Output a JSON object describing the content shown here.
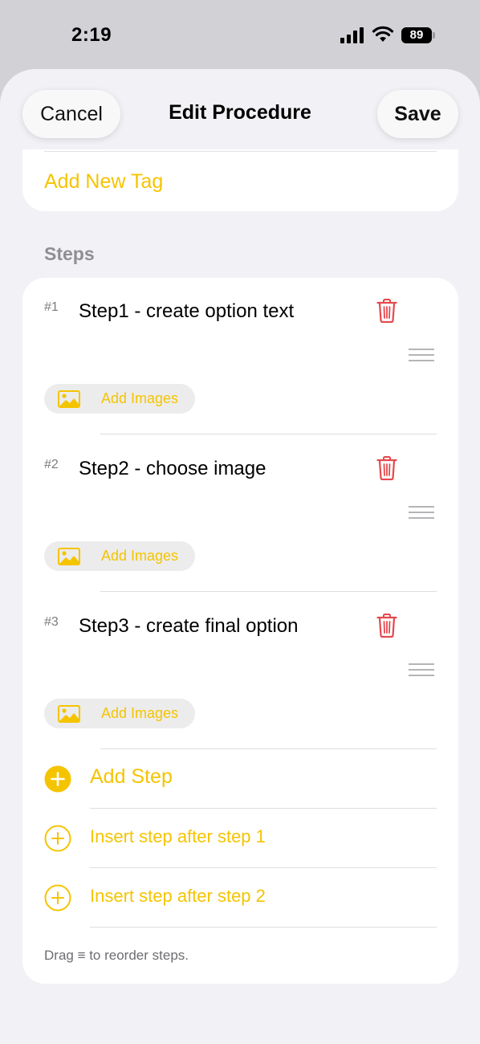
{
  "status_bar": {
    "time": "2:19",
    "battery_level": "89"
  },
  "nav": {
    "cancel_label": "Cancel",
    "title": "Edit Procedure",
    "save_label": "Save"
  },
  "tags": {
    "add_tag_label": "Add New Tag"
  },
  "steps_section": {
    "header": "Steps",
    "add_images_label": "Add Images",
    "items": [
      {
        "number": "#1",
        "text": "Step1 - create option text"
      },
      {
        "number": "#2",
        "text": "Step2 - choose image"
      },
      {
        "number": "#3",
        "text": "Step3 - create final option"
      }
    ],
    "actions": {
      "add_step": "Add Step",
      "insert_after_1": "Insert step after step 1",
      "insert_after_2": "Insert step after step 2"
    },
    "hint": "Drag ≡ to reorder steps."
  },
  "colors": {
    "accent": "#f5c400",
    "destructive": "#e5484d",
    "background": "#f2f2f6",
    "card": "#ffffff"
  },
  "icons": {
    "signal": "cellular-signal-icon",
    "wifi": "wifi-icon",
    "battery": "battery-icon",
    "trash": "trash-icon",
    "drag": "drag-handle-icon",
    "image": "image-icon",
    "add_filled": "plus-circle-filled-icon",
    "add_outline": "plus-circle-outline-icon"
  }
}
